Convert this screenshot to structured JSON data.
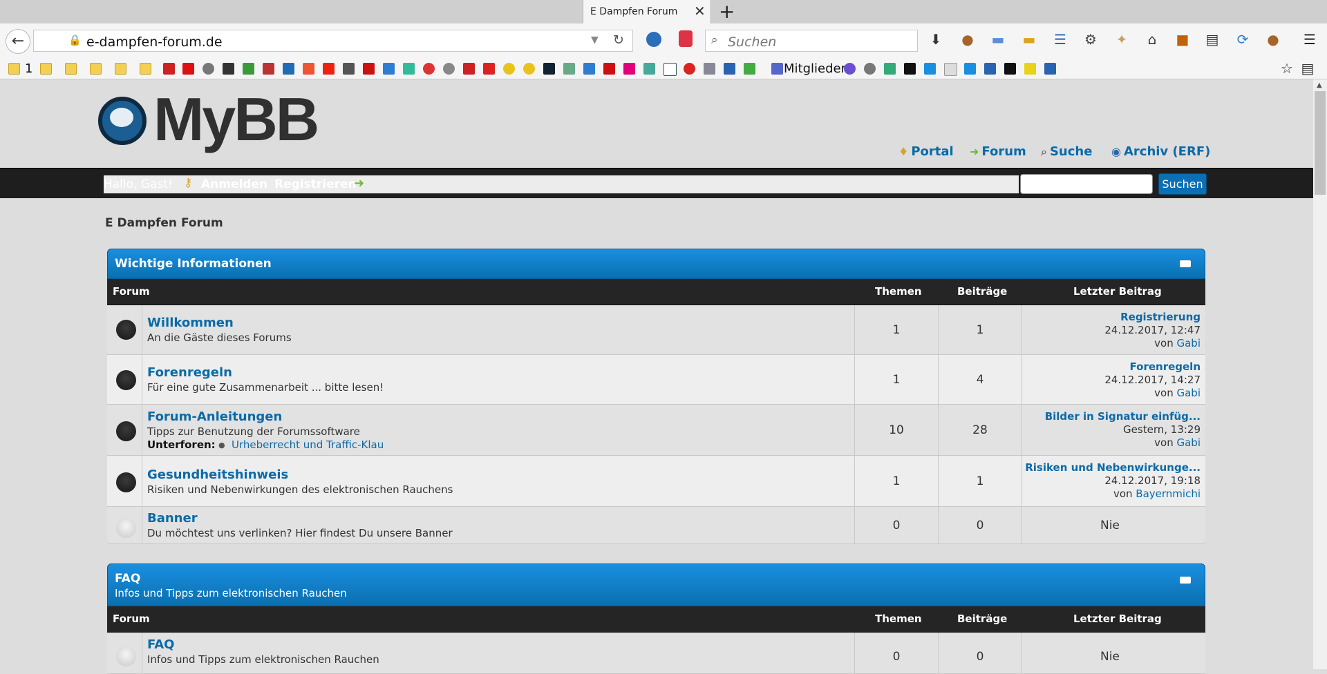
{
  "browser": {
    "tab_title": "E Dampfen Forum",
    "tab_close": "✕",
    "new_tab": "+",
    "back": "←",
    "url": "e-dampfen-forum.de",
    "search_placeholder": "Suchen",
    "bookmarks_count": "1",
    "bookmark_mitglieder": "Mitglieder"
  },
  "site": {
    "logo": "MyBB",
    "nav": [
      {
        "label": "Portal",
        "icon": "bell-icon"
      },
      {
        "label": "Forum",
        "icon": "arrow-icon"
      },
      {
        "label": "Suche",
        "icon": "magnifier-icon"
      },
      {
        "label": "Archiv (ERF)",
        "icon": "archive-icon"
      }
    ],
    "greeting": "Hallo, Gast!",
    "login": "Anmelden",
    "register": "Registrieren",
    "search_button": "Suchen",
    "breadcrumb": "E Dampfen Forum"
  },
  "columns": {
    "forum": "Forum",
    "themen": "Themen",
    "beitraege": "Beiträge",
    "letzter": "Letzter Beitrag"
  },
  "categories": [
    {
      "title": "Wichtige Informationen",
      "forums": [
        {
          "name": "Willkommen",
          "desc": "An die Gäste dieses Forums",
          "themen": "1",
          "beitraege": "1",
          "last_title": "Registrierung",
          "last_date": "24.12.2017, 12:47",
          "last_by": "von",
          "last_user": "Gabi"
        },
        {
          "name": "Forenregeln",
          "desc": "Für eine gute Zusammenarbeit ... bitte lesen!",
          "themen": "1",
          "beitraege": "4",
          "last_title": "Forenregeln",
          "last_date": "24.12.2017, 14:27",
          "last_by": "von",
          "last_user": "Gabi"
        },
        {
          "name": "Forum-Anleitungen",
          "desc": "Tipps zur Benutzung der Forumssoftware",
          "themen": "10",
          "beitraege": "28",
          "subforums_label": "Unterforen:",
          "subforum": "Urheberrecht und Traffic-Klau",
          "last_title": "Bilder in Signatur einfüg...",
          "last_date": "Gestern, 13:29",
          "last_by": "von",
          "last_user": "Gabi"
        },
        {
          "name": "Gesundheitshinweis",
          "desc": "Risiken und Nebenwirkungen des elektronischen Rauchens",
          "themen": "1",
          "beitraege": "1",
          "last_title": "Risiken und Nebenwirkunge...",
          "last_date": "24.12.2017, 19:18",
          "last_by": "von",
          "last_user": "Bayernmichi"
        },
        {
          "name": "Banner",
          "desc": "Du möchtest uns verlinken? Hier findest Du unsere Banner",
          "themen": "0",
          "beitraege": "0",
          "last_none": "Nie"
        }
      ]
    },
    {
      "title": "FAQ",
      "subtitle": "Infos und Tipps zum elektronischen Rauchen",
      "forums": [
        {
          "name": "FAQ",
          "desc": "Infos und Tipps zum elektronischen Rauchen",
          "themen": "0",
          "beitraege": "0",
          "last_none": "Nie"
        }
      ]
    }
  ]
}
